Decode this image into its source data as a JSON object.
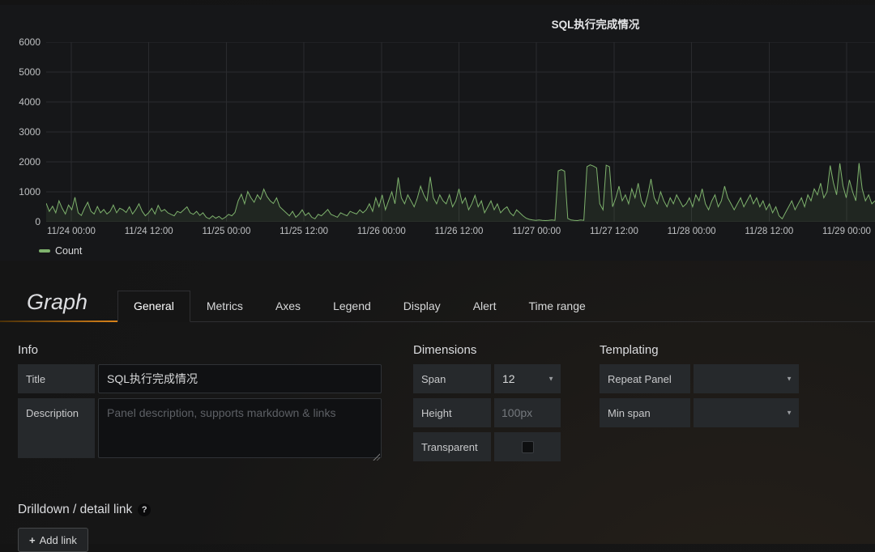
{
  "panel": {
    "title": "SQL执行完成情况",
    "legend": [
      {
        "label": "Count",
        "color": "#7eb26d"
      }
    ]
  },
  "chart_data": {
    "type": "line",
    "title": "SQL执行完成情况",
    "ylim": [
      0,
      6000
    ],
    "grid": true,
    "legend_position": "bottom-left",
    "y_ticks": [
      0,
      1000,
      2000,
      3000,
      4000,
      5000,
      6000
    ],
    "x_ticks": [
      "11/24 00:00",
      "11/24 12:00",
      "11/25 00:00",
      "11/25 12:00",
      "11/26 00:00",
      "11/26 12:00",
      "11/27 00:00",
      "11/27 12:00",
      "11/28 00:00",
      "11/28 12:00",
      "11/29 00:00"
    ],
    "series": [
      {
        "name": "Count",
        "color": "#7eb26d",
        "fill": "rgba(126,178,109,0.10)",
        "values": [
          620,
          350,
          520,
          300,
          700,
          450,
          260,
          560,
          400,
          820,
          300,
          210,
          460,
          650,
          350,
          260,
          510,
          300,
          410,
          260,
          350,
          560,
          300,
          450,
          400,
          310,
          500,
          260,
          410,
          600,
          350,
          200,
          300,
          450,
          260,
          550,
          350,
          410,
          300,
          250,
          200,
          350,
          300,
          400,
          500,
          300,
          250,
          350,
          210,
          300,
          150,
          100,
          200,
          120,
          180,
          90,
          150,
          250,
          200,
          310,
          700,
          920,
          600,
          1010,
          800,
          650,
          900,
          750,
          1090,
          850,
          700,
          610,
          800,
          500,
          400,
          300,
          200,
          350,
          150,
          250,
          400,
          210,
          300,
          150,
          100,
          250,
          200,
          300,
          410,
          250,
          200,
          150,
          300,
          250,
          200,
          350,
          300,
          260,
          400,
          300,
          400,
          600,
          350,
          800,
          500,
          900,
          400,
          700,
          1000,
          600,
          1479,
          800,
          600,
          900,
          700,
          500,
          800,
          1190,
          900,
          700,
          1500,
          800,
          600,
          900,
          700,
          600,
          900,
          500,
          700,
          1100,
          620,
          800,
          400,
          600,
          880,
          500,
          700,
          300,
          500,
          700,
          400,
          600,
          300,
          420,
          500,
          300,
          200,
          400,
          300,
          200,
          120,
          80,
          60,
          50,
          60,
          50,
          40,
          50,
          60,
          50,
          1700,
          1740,
          1690,
          110,
          60,
          50,
          40,
          60,
          50,
          1840,
          1900,
          1860,
          1800,
          600,
          400,
          1890,
          1840,
          500,
          800,
          1190,
          700,
          900,
          600,
          1100,
          800,
          1290,
          700,
          500,
          900,
          1430,
          800,
          600,
          1000,
          700,
          500,
          800,
          600,
          900,
          700,
          500,
          600,
          800,
          500,
          900,
          700,
          1100,
          600,
          400,
          700,
          900,
          500,
          700,
          1190,
          800,
          600,
          400,
          600,
          800,
          500,
          700,
          900,
          600,
          800,
          500,
          700,
          400,
          600,
          300,
          500,
          200,
          100,
          300,
          500,
          700,
          400,
          600,
          800,
          500,
          900,
          700,
          1100,
          900,
          1290,
          800,
          1000,
          1879,
          1300,
          900,
          1950,
          1200,
          800,
          1400,
          1000,
          700,
          1958,
          1100,
          700,
          900,
          600,
          700
        ]
      }
    ]
  },
  "editor": {
    "panel_type": "Graph",
    "tabs": [
      {
        "label": "General",
        "active": true
      },
      {
        "label": "Metrics",
        "active": false
      },
      {
        "label": "Axes",
        "active": false
      },
      {
        "label": "Legend",
        "active": false
      },
      {
        "label": "Display",
        "active": false
      },
      {
        "label": "Alert",
        "active": false
      },
      {
        "label": "Time range",
        "active": false
      }
    ],
    "sections": {
      "info": {
        "heading": "Info",
        "title_label": "Title",
        "title_value": "SQL执行完成情况",
        "description_label": "Description",
        "description_placeholder": "Panel description, supports markdown & links"
      },
      "dimensions": {
        "heading": "Dimensions",
        "span_label": "Span",
        "span_value": "12",
        "height_label": "Height",
        "height_placeholder": "100px",
        "transparent_label": "Transparent",
        "transparent_checked": false
      },
      "templating": {
        "heading": "Templating",
        "repeat_label": "Repeat Panel",
        "repeat_value": "",
        "minspan_label": "Min span",
        "minspan_value": ""
      }
    },
    "drilldown": {
      "heading": "Drilldown / detail link",
      "help_icon": "?",
      "plus_icon": "+",
      "add_link_label": "Add link"
    }
  }
}
